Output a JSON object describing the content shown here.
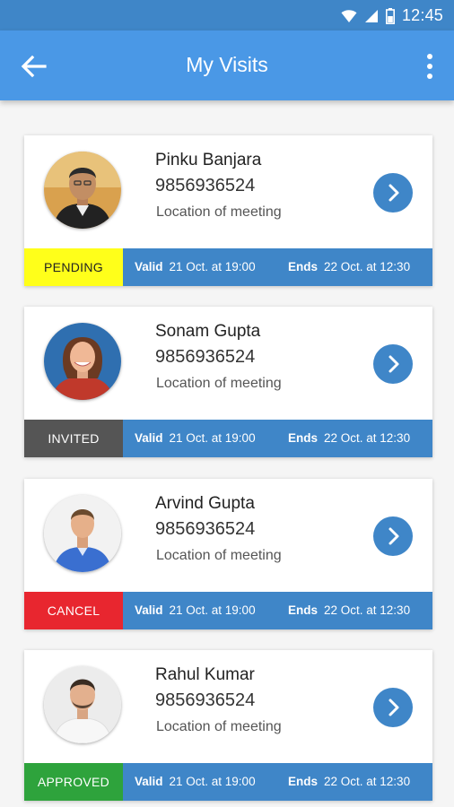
{
  "status_bar": {
    "time": "12:45",
    "icons": [
      "wifi-icon",
      "signal-icon",
      "battery-icon"
    ]
  },
  "app_bar": {
    "title": "My Visits",
    "back_icon": "arrow-back-icon",
    "menu_icon": "more-vertical-icon"
  },
  "colors": {
    "app_bar": "#4a98e6",
    "status_bar": "#3f86c8",
    "accent_blue": "#3f86c8",
    "pending": "#ffff1a",
    "invited": "#555555",
    "cancel": "#e8262f",
    "approved": "#2ea33c"
  },
  "visits": [
    {
      "name": "Pinku Banjara",
      "phone": "9856936524",
      "location": "Location of meeting",
      "status": "PENDING",
      "valid_label": "Valid",
      "valid_value": "21 Oct. at 19:00",
      "ends_label": "Ends",
      "ends_value": "22 Oct. at 12:30"
    },
    {
      "name": "Sonam Gupta",
      "phone": "9856936524",
      "location": "Location of meeting",
      "status": "INVITED",
      "valid_label": "Valid",
      "valid_value": "21 Oct. at 19:00",
      "ends_label": "Ends",
      "ends_value": "22 Oct. at 12:30"
    },
    {
      "name": "Arvind Gupta",
      "phone": "9856936524",
      "location": "Location of meeting",
      "status": "CANCEL",
      "valid_label": "Valid",
      "valid_value": "21 Oct. at 19:00",
      "ends_label": "Ends",
      "ends_value": "22 Oct. at 12:30"
    },
    {
      "name": "Rahul Kumar",
      "phone": "9856936524",
      "location": "Location of meeting",
      "status": "APPROVED",
      "valid_label": "Valid",
      "valid_value": "21 Oct. at 19:00",
      "ends_label": "Ends",
      "ends_value": "22 Oct. at 12:30"
    }
  ]
}
